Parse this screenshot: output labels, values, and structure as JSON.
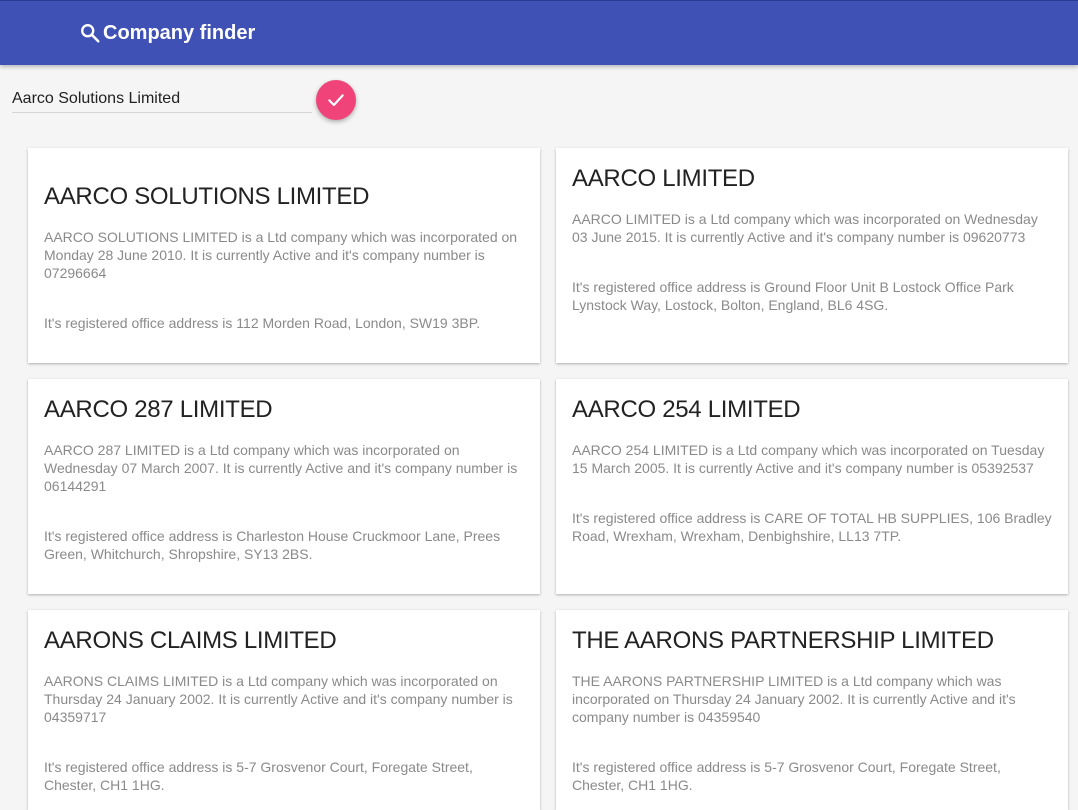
{
  "header": {
    "title": "Company finder",
    "icon": "search-icon",
    "background": "#3f51b5"
  },
  "search": {
    "value": "Aarco Solutions Limited",
    "placeholder": "",
    "button_icon": "check-icon",
    "button_color": "#f0437a"
  },
  "companies": [
    {
      "name": "AARCO SOLUTIONS LIMITED",
      "description": "AARCO SOLUTIONS LIMITED is a Ltd company which was incorporated on Monday 28 June 2010. It is currently Active and it's company number is 07296664",
      "address": "It's registered office address is 112 Morden Road, London, SW19 3BP."
    },
    {
      "name": "AARCO LIMITED",
      "description": "AARCO LIMITED is a Ltd company which was incorporated on Wednesday 03 June 2015. It is currently Active and it's company number is 09620773",
      "address": "It's registered office address is Ground Floor Unit B Lostock Office Park Lynstock Way, Lostock, Bolton, England, BL6 4SG."
    },
    {
      "name": "AARCO 287 LIMITED",
      "description": "AARCO 287 LIMITED is a Ltd company which was incorporated on Wednesday 07 March 2007. It is currently Active and it's company number is 06144291",
      "address": "It's registered office address is Charleston House Cruckmoor Lane, Prees Green, Whitchurch, Shropshire, SY13 2BS."
    },
    {
      "name": "AARCO 254 LIMITED",
      "description": "AARCO 254 LIMITED is a Ltd company which was incorporated on Tuesday 15 March 2005. It is currently Active and it's company number is 05392537",
      "address": "It's registered office address is CARE OF TOTAL HB SUPPLIES, 106 Bradley Road, Wrexham, Wrexham, Denbighshire, LL13 7TP."
    },
    {
      "name": "AARONS CLAIMS LIMITED",
      "description": "AARONS CLAIMS LIMITED is a Ltd company which was incorporated on Thursday 24 January 2002. It is currently Active and it's company number is 04359717",
      "address": "It's registered office address is 5-7 Grosvenor Court, Foregate Street, Chester, CH1 1HG."
    },
    {
      "name": "THE AARONS PARTNERSHIP LIMITED",
      "description": "THE AARONS PARTNERSHIP LIMITED is a Ltd company which was incorporated on Thursday 24 January 2002. It is currently Active and it's company number is 04359540",
      "address": "It's registered office address is 5-7 Grosvenor Court, Foregate Street, Chester, CH1 1HG."
    }
  ]
}
